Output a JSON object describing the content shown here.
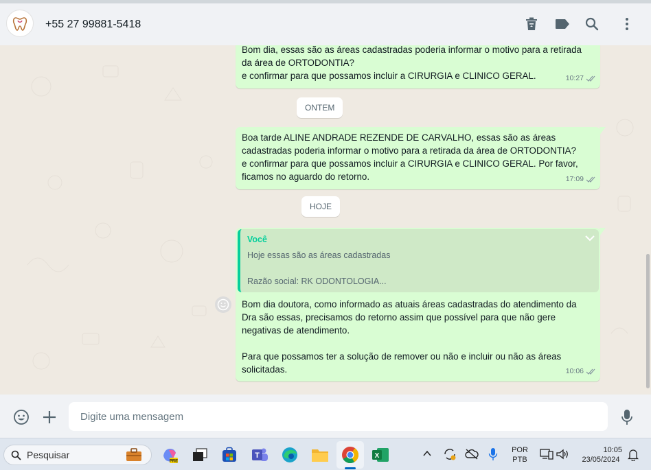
{
  "header": {
    "contact_name": "+55 27 99881-5418",
    "icons": [
      "delete-icon",
      "label-icon",
      "search-icon",
      "menu-icon"
    ]
  },
  "messages": [
    {
      "text": "Bom dia, essas são as áreas cadastradas poderia informar o motivo para a retirada\nda área de ORTODONTIA?\ne confirmar para que possamos incluir a CIRURGIA e CLINICO GERAL.",
      "time": "10:27"
    },
    {
      "text": "Boa tarde ALINE ANDRADE REZENDE DE CARVALHO, essas são as áreas\ncadastradas poderia informar o motivo para a retirada da área de ORTODONTIA?\ne confirmar para que possamos incluir a CIRURGIA e CLINICO GERAL. Por favor,\nficamos no aguardo do retorno.",
      "time": "17:09"
    },
    {
      "quote_author": "Você",
      "quote_line1": "Hoje essas são as áreas cadastradas",
      "quote_line2": "Razão social: RK ODONTOLOGIA...",
      "text": "Bom dia doutora, como informado as atuais áreas cadastradas do atendimento da\nDra são essas, precisamos do retorno assim que possível para que não gere\nnegativas de atendimento.\n\nPara que possamos ter a solução de remover ou não e incluir ou não as áreas\nsolicitadas.",
      "time": "10:06"
    }
  ],
  "dates": {
    "yesterday": "ONTEM",
    "today": "HOJE"
  },
  "footer": {
    "placeholder": "Digite uma mensagem"
  },
  "taskbar": {
    "search_label": "Pesquisar",
    "lang_top": "POR",
    "lang_bottom": "PTB",
    "time": "10:05",
    "date": "23/05/2024",
    "apps": [
      "copilot-icon",
      "task-view-icon",
      "store-icon",
      "teams-icon",
      "edge-icon",
      "explorer-icon",
      "chrome-icon",
      "excel-icon"
    ]
  },
  "colors": {
    "bubble": "#d9fdd3",
    "accent": "#06cf9c",
    "chat_bg": "#efeae2"
  }
}
